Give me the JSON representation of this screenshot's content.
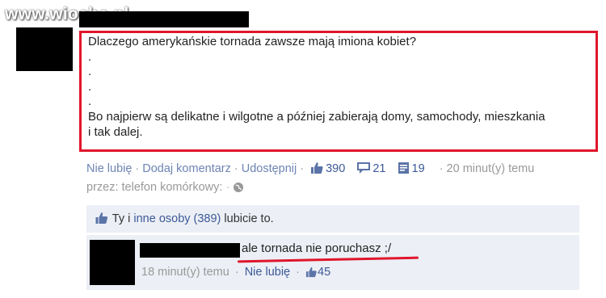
{
  "watermark": "www.wiocha.pl",
  "post": {
    "lines": [
      "Dlaczego amerykańskie tornada zawsze mają imiona kobiet?",
      ".",
      ".",
      ".",
      ".",
      "Bo najpierw są delikatne i wilgotne a później zabierają domy, samochody, mieszkania",
      "i tak dalej."
    ]
  },
  "actions": {
    "unlike": "Nie lubię",
    "comment": "Dodaj komentarz",
    "share": "Udostępnij",
    "likes_count": "390",
    "comments_count": "21",
    "shares_count": "19",
    "time": "20 minut(y) temu",
    "via": "przez: telefon komórkowy:"
  },
  "likes_summary": {
    "prefix": "Ty i",
    "others": "inne osoby (389)",
    "suffix": "lubicie to."
  },
  "comment": {
    "text": "ale tornada nie poruchasz ;/",
    "time": "18 minut(y) temu",
    "unlike": "Nie lubię",
    "likes": "45"
  },
  "colors": {
    "highlight_red": "#e0162b",
    "link_blue": "#6d84b4",
    "panel_bg": "#eceff5"
  }
}
